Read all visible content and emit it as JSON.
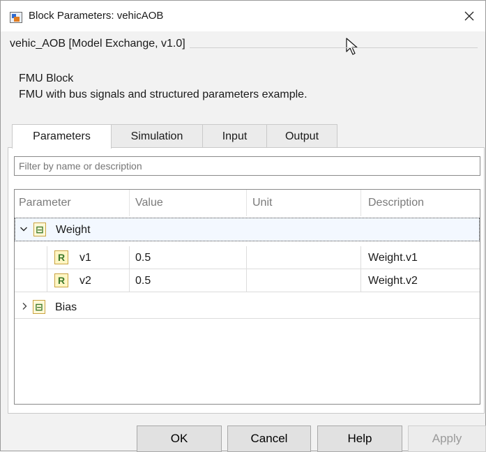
{
  "window": {
    "title": "Block Parameters: vehicAOB"
  },
  "block": {
    "group_title": "vehic_AOB [Model Exchange, v1.0]",
    "type_label": "FMU Block",
    "description": "FMU with bus signals and structured parameters example."
  },
  "tabs": [
    {
      "label": "Parameters",
      "active": true
    },
    {
      "label": "Simulation",
      "active": false
    },
    {
      "label": "Input",
      "active": false
    },
    {
      "label": "Output",
      "active": false
    }
  ],
  "filter": {
    "placeholder": "Filter by name or description",
    "value": ""
  },
  "table": {
    "columns": [
      "Parameter",
      "Value",
      "Unit",
      "Description"
    ],
    "rows": [
      {
        "name": "Weight",
        "value": "",
        "unit": "",
        "description": "",
        "kind": "struct",
        "expanded": true
      },
      {
        "name": "v1",
        "value": "0.5",
        "unit": "",
        "description": "Weight.v1",
        "kind": "real"
      },
      {
        "name": "v2",
        "value": "0.5",
        "unit": "",
        "description": "Weight.v2",
        "kind": "real"
      },
      {
        "name": "Bias",
        "value": "",
        "unit": "",
        "description": "",
        "kind": "struct",
        "expanded": false
      }
    ]
  },
  "buttons": {
    "ok": "OK",
    "cancel": "Cancel",
    "help": "Help",
    "apply": "Apply",
    "apply_enabled": false
  },
  "icons": {
    "title_icon": "simulink-block-icon",
    "close": "close-icon",
    "struct": "struct-icon",
    "real": "real-param-icon",
    "cursor": "mouse-pointer-icon"
  }
}
